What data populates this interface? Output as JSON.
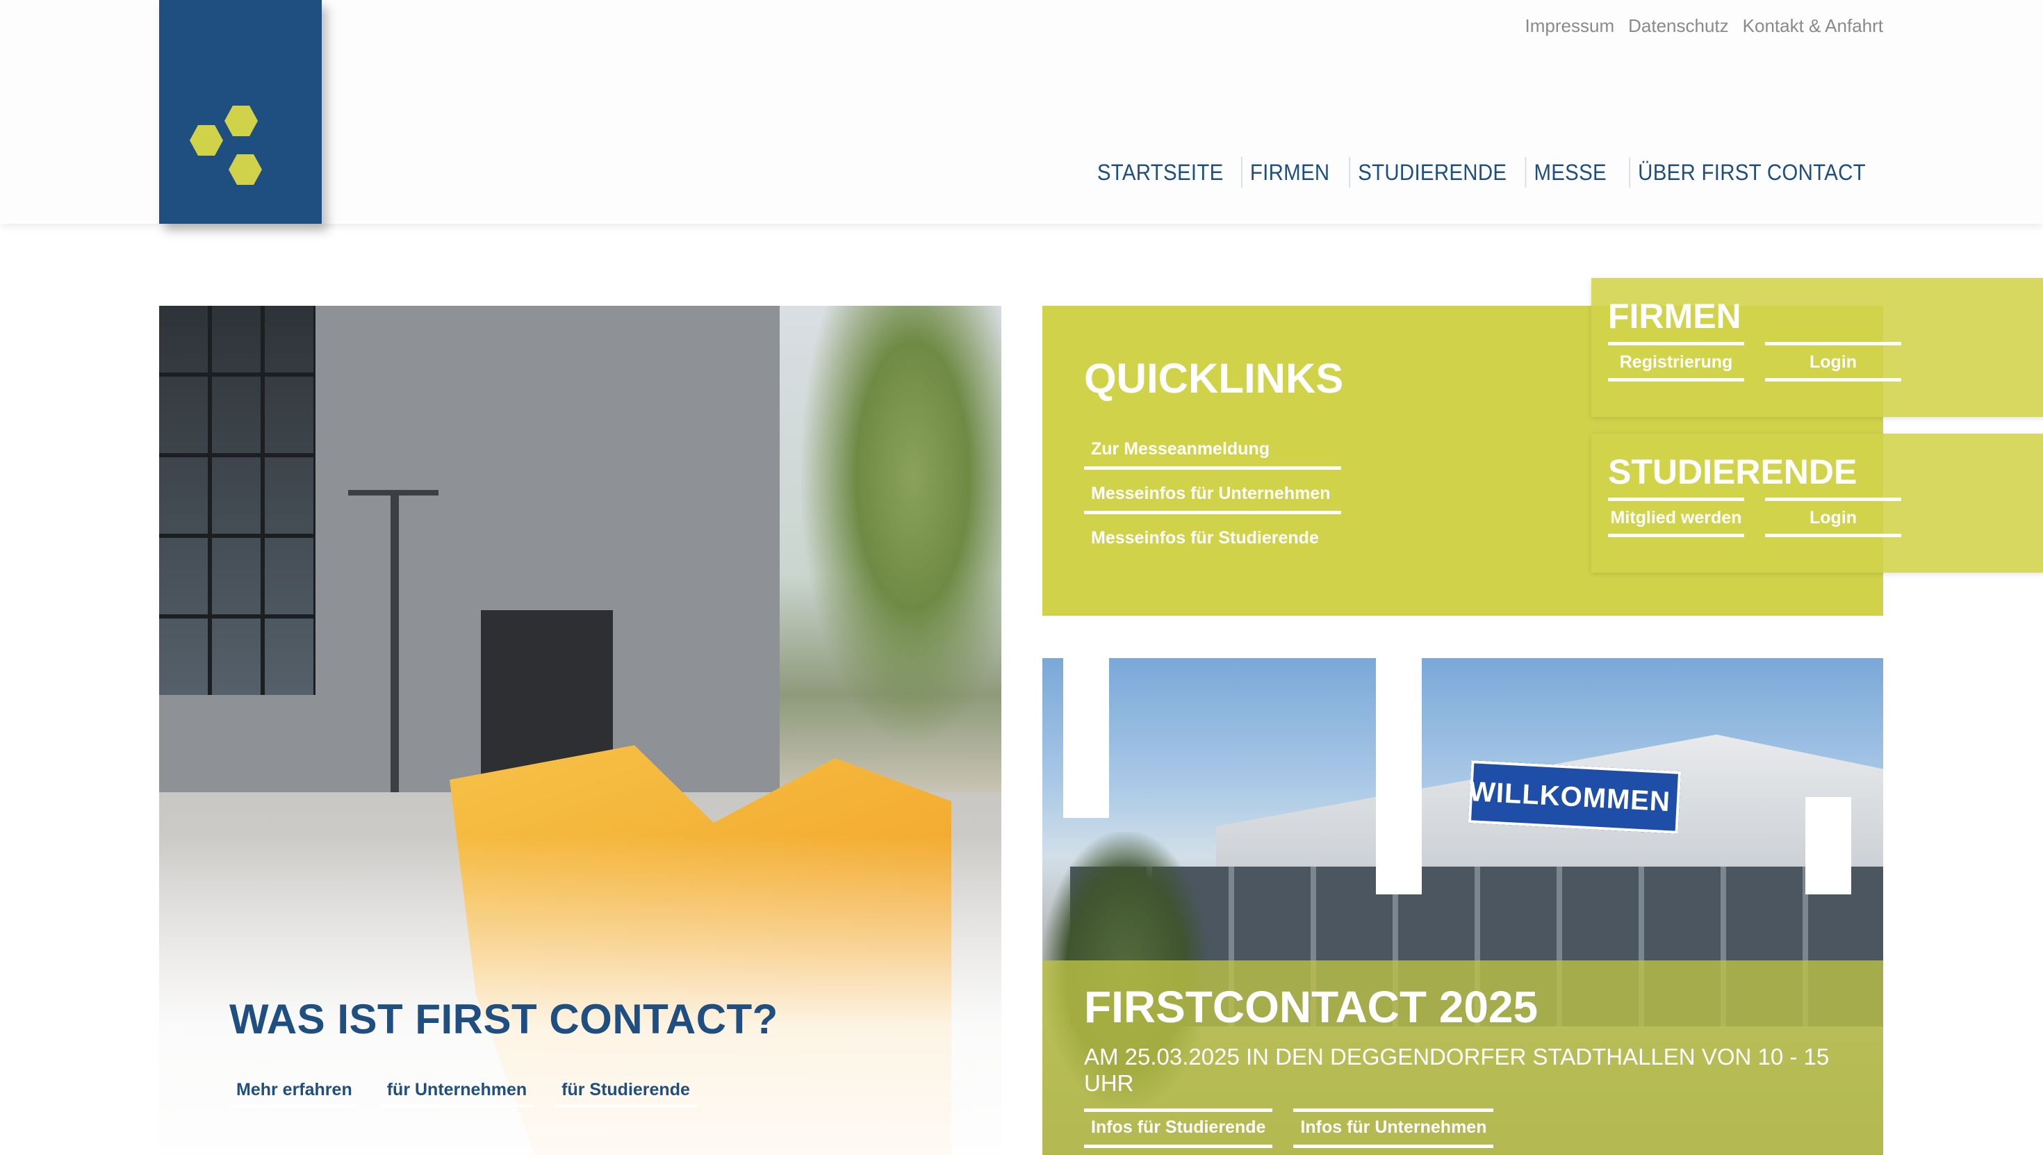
{
  "top_links": [
    "Impressum",
    "Datenschutz",
    "Kontakt & Anfahrt"
  ],
  "main_nav": [
    "STARTSEITE",
    "FIRMEN",
    "STUDIERENDE",
    "MESSE",
    "ÜBER FIRST CONTACT"
  ],
  "hero_left": {
    "title": "WAS IST FIRST CONTACT?",
    "links": [
      "Mehr erfahren",
      "für Unternehmen",
      "für Studierende"
    ]
  },
  "quicklinks": {
    "title": "QUICKLINKS",
    "links": [
      "Zur Messeanmeldung",
      "Messeinfos für Unternehmen",
      "Messeinfos für Studierende"
    ]
  },
  "sidebox_firmen": {
    "title": "FIRMEN",
    "buttons": [
      "Registrierung",
      "Login"
    ]
  },
  "sidebox_studierende": {
    "title": "STUDIERENDE",
    "buttons": [
      "Mitglied werden",
      "Login"
    ]
  },
  "event": {
    "sign_text": "WILLKOMMEN",
    "title": "FIRSTCONTACT 2025",
    "subtitle": "AM 25.03.2025 IN DEN DEGGENDORFER STADTHALLEN VON 10 - 15 UHR",
    "links": [
      "Infos für Studierende",
      "Infos für Unternehmen"
    ]
  },
  "colors": {
    "brand_blue": "#1f4e80",
    "brand_lime": "#d0d34a"
  }
}
